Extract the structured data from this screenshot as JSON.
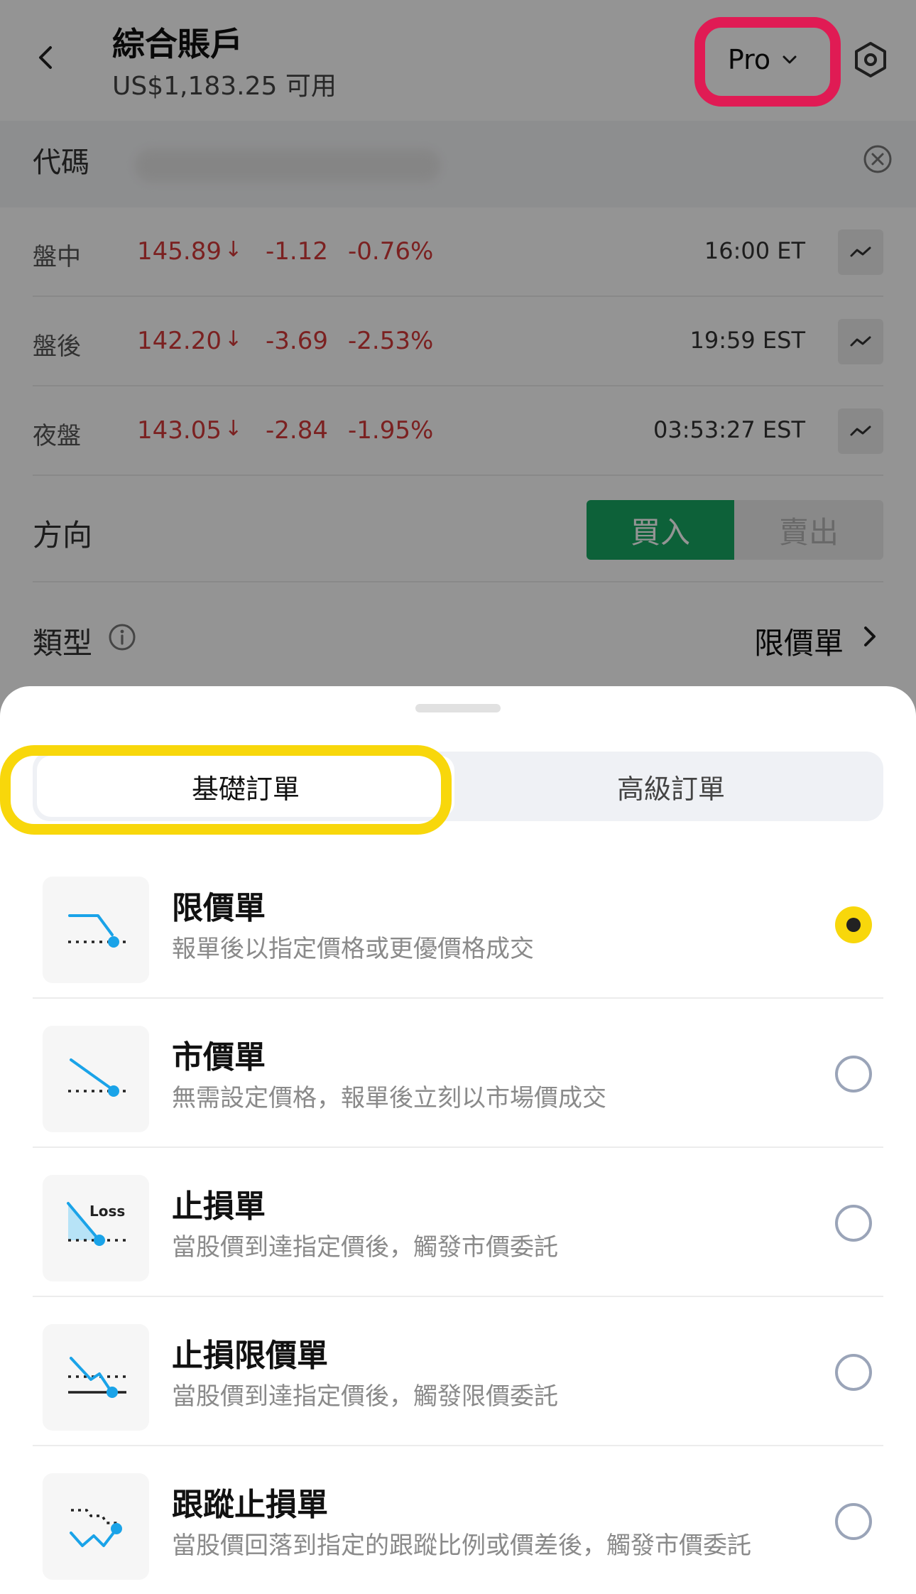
{
  "header": {
    "title": "綜合賬戶",
    "available": "US$1,183.25 可用",
    "pro_label": "Pro"
  },
  "code": {
    "label": "代碼"
  },
  "quotes": [
    {
      "session": "盤中",
      "price": "145.89",
      "arrow": "↓",
      "change": "-1.12",
      "pct": "-0.76%",
      "time": "16:00 ET"
    },
    {
      "session": "盤後",
      "price": "142.20",
      "arrow": "↓",
      "change": "-3.69",
      "pct": "-2.53%",
      "time": "19:59 EST"
    },
    {
      "session": "夜盤",
      "price": "143.05",
      "arrow": "↓",
      "change": "-2.84",
      "pct": "-1.95%",
      "time": "03:53:27 EST"
    }
  ],
  "direction": {
    "label": "方向",
    "buy": "買入",
    "sell": "賣出"
  },
  "type": {
    "label": "類型",
    "value": "限價單"
  },
  "sheet": {
    "tabs": [
      "基礎訂單",
      "高級訂單"
    ],
    "options": [
      {
        "title": "限價單",
        "desc": "報單後以指定價格或更優價格成交",
        "selected": true
      },
      {
        "title": "市價單",
        "desc": "無需設定價格，報單後立刻以市場價成交",
        "selected": false
      },
      {
        "title": "止損單",
        "desc": "當股價到達指定價後，觸發市價委託",
        "selected": false,
        "icon_text": "Loss"
      },
      {
        "title": "止損限價單",
        "desc": "當股價到達指定價後，觸發限價委託",
        "selected": false
      },
      {
        "title": "跟蹤止損單",
        "desc": "當股價回落到指定的跟蹤比例或價差後，觸發市價委託",
        "selected": false
      }
    ]
  },
  "colors": {
    "accent_green": "#17a862",
    "price_down_red": "#d43a3a",
    "highlight_red": "#e01b54",
    "highlight_yellow": "#f8d70b",
    "icon_blue": "#1aa3e8"
  }
}
